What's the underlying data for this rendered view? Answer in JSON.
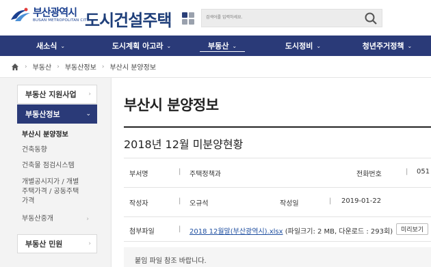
{
  "header": {
    "logo_kor": "부산광역시",
    "logo_eng": "BUSAN METROPOLITAN CITY",
    "site_title": "도시건설주택",
    "search_placeholder": "검색어를 입력하세요."
  },
  "gnb": {
    "items": [
      {
        "label": "새소식",
        "chevron": "⌄"
      },
      {
        "label": "도시계획 아고라",
        "chevron": "⌄"
      },
      {
        "label": "부동산",
        "chevron": "⌄"
      },
      {
        "label": "도시정비",
        "chevron": "⌄"
      },
      {
        "label": "청년주거정책",
        "chevron": "⌄"
      }
    ],
    "active_index": 2
  },
  "breadcrumb": [
    "부동산",
    "부동산정보",
    "부산시 분양정보"
  ],
  "lnb": {
    "menus": [
      {
        "label": "부동산 지원사업"
      },
      {
        "label": "부동산정보"
      },
      {
        "label": "부동산 민원"
      }
    ],
    "sub_items": [
      {
        "label": "부산시 분양정보"
      },
      {
        "label": "건축동향"
      },
      {
        "label": "건축물 점검시스템"
      },
      {
        "label": "개별공시지가 / 개별주택가격 / 공동주택가격"
      },
      {
        "label": "부동산중개"
      }
    ]
  },
  "content": {
    "page_title": "부산시 분양정보",
    "post_title": "2018년 12월 미분양현황",
    "dept_label": "부서명",
    "dept_value": "주택정책과",
    "phone_label": "전화번호",
    "phone_value": "051",
    "author_label": "작성자",
    "author_value": "오규석",
    "date_label": "작성일",
    "date_value": "2019-01-22",
    "file_label": "첨부파일",
    "file_name": "2018 12월말(부산광역시).xlsx",
    "file_meta": "(파일크기: 2 MB, 다운로드 : 293회)",
    "preview_label": "미리보기",
    "notice_text": "붙임 파일 참조 바랍니다."
  },
  "colors": {
    "nav_bg": "#2a3a78",
    "title_blue": "#1f3f7a",
    "link_blue": "#1f4fa0"
  }
}
